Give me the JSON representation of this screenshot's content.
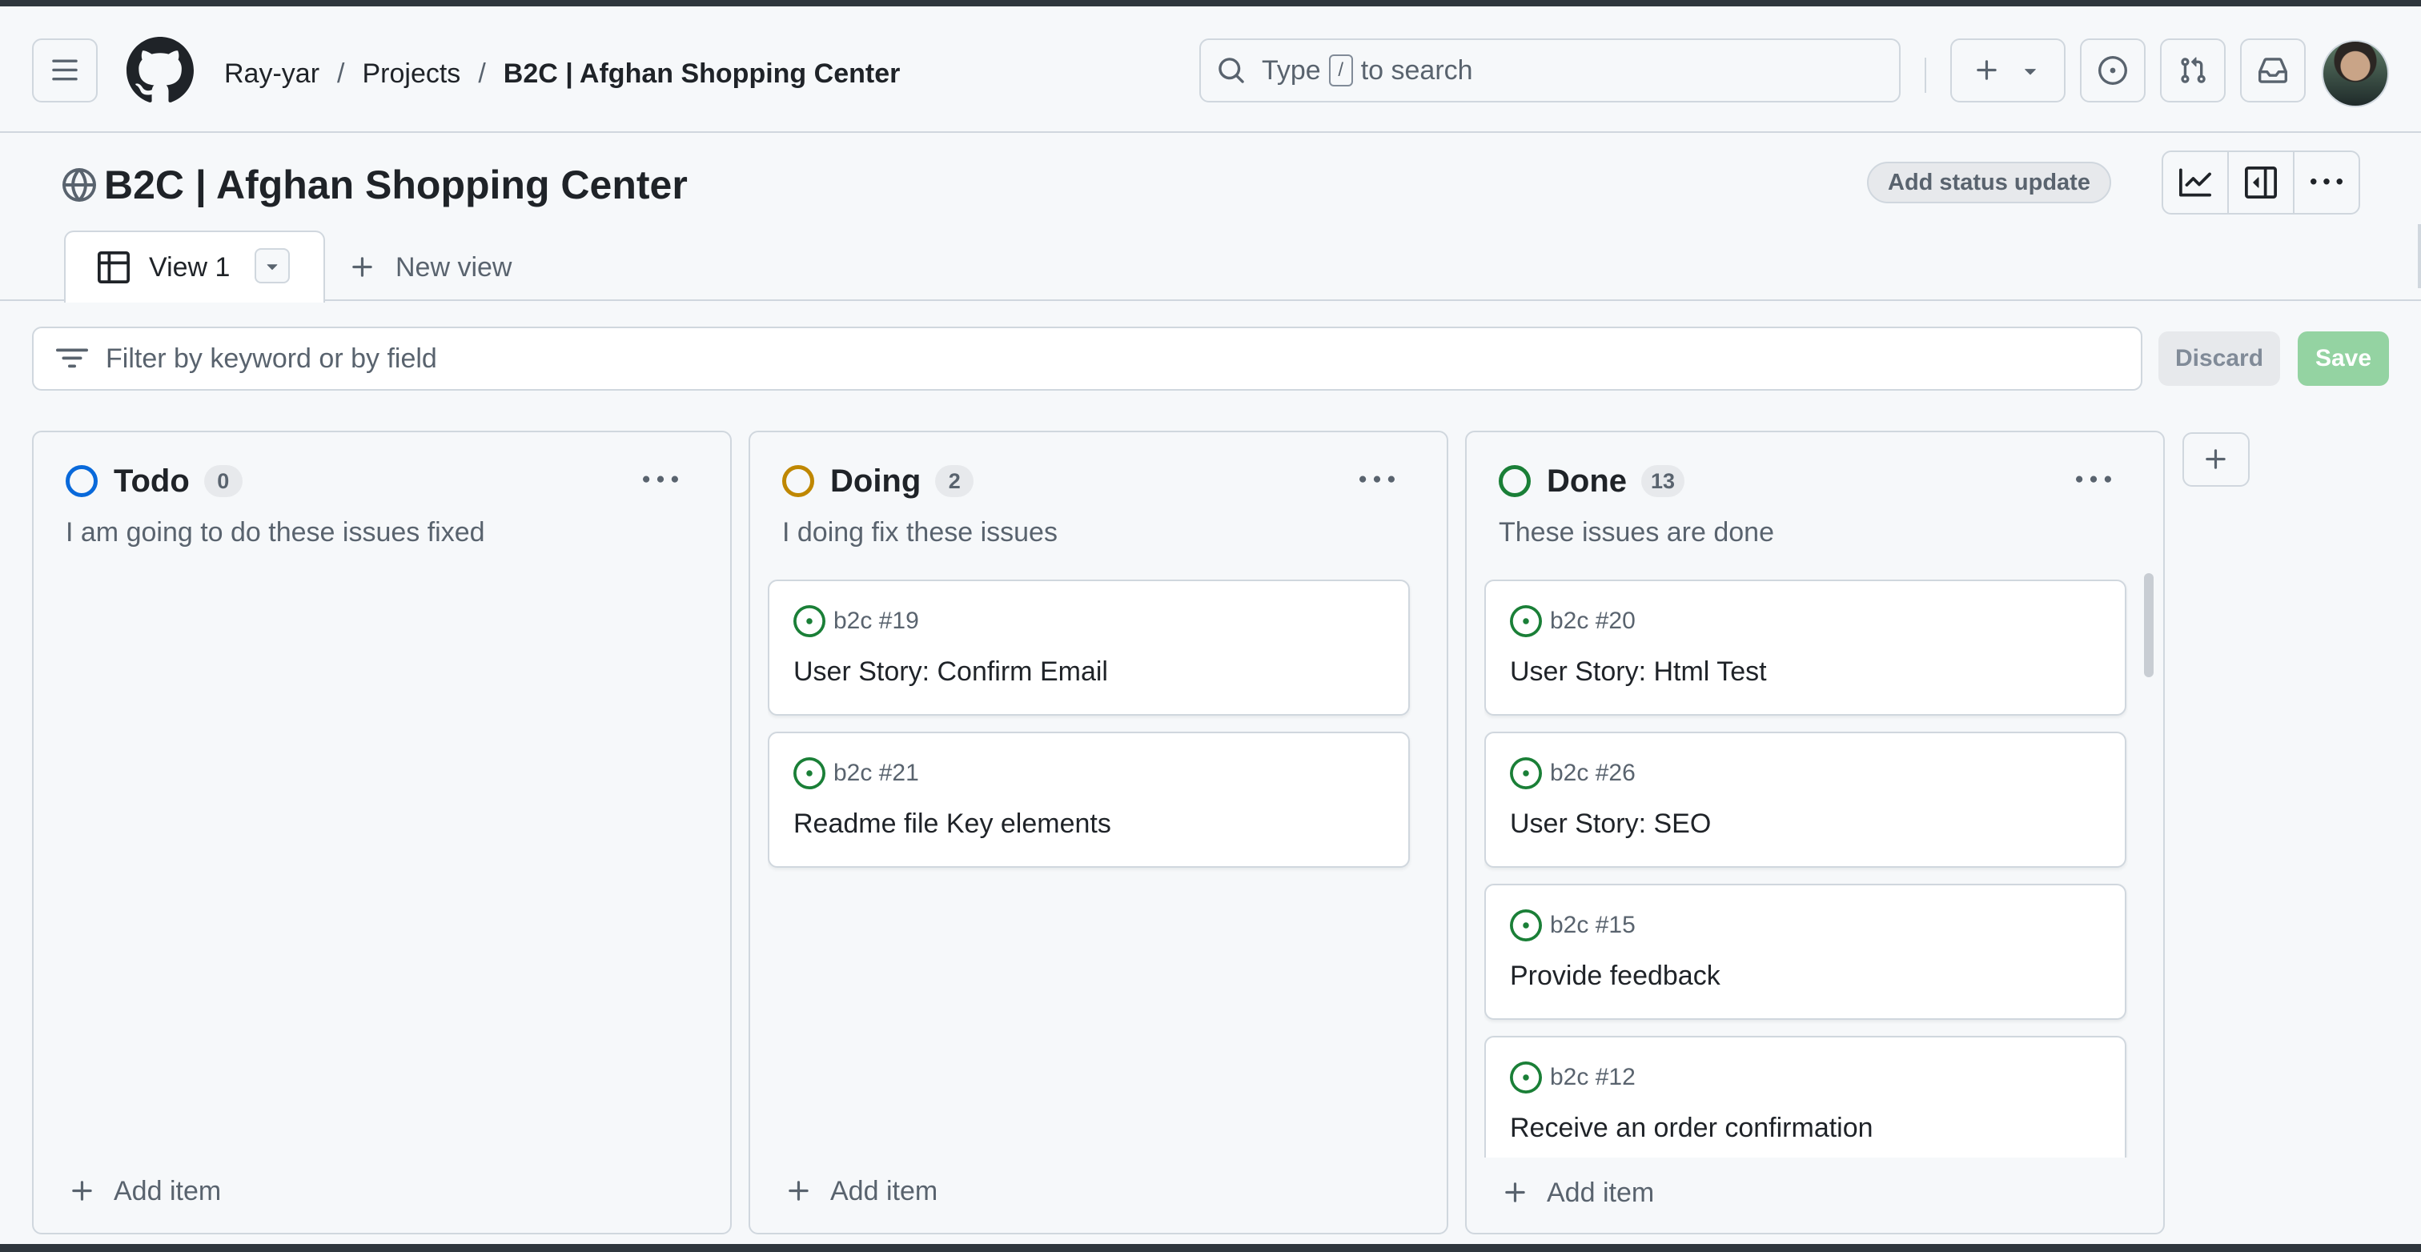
{
  "header": {
    "breadcrumbs": [
      "Ray-yar",
      "Projects",
      "B2C | Afghan Shopping Center"
    ],
    "search": {
      "prefix": "Type",
      "key": "/",
      "suffix": "to search"
    }
  },
  "project": {
    "title": "B2C | Afghan Shopping Center",
    "status_button": "Add status update"
  },
  "views": {
    "active_tab": "View 1",
    "new_view": "New view"
  },
  "filter": {
    "placeholder": "Filter by keyword or by field",
    "discard": "Discard",
    "save": "Save"
  },
  "columns": [
    {
      "name": "Todo",
      "count": "0",
      "color": "#0969da",
      "description": "I am going to do these issues fixed",
      "cards": [],
      "add_item": "Add item"
    },
    {
      "name": "Doing",
      "count": "2",
      "color": "#bf8700",
      "description": "I doing fix these issues",
      "cards": [
        {
          "ref": "b2c #19",
          "title": "User Story: Confirm Email"
        },
        {
          "ref": "b2c #21",
          "title": "Readme file Key elements"
        }
      ],
      "add_item": "Add item"
    },
    {
      "name": "Done",
      "count": "13",
      "color": "#1a7f37",
      "description": "These issues are done",
      "cards": [
        {
          "ref": "b2c #20",
          "title": "User Story: Html Test"
        },
        {
          "ref": "b2c #26",
          "title": "User Story: SEO"
        },
        {
          "ref": "b2c #15",
          "title": "Provide feedback"
        },
        {
          "ref": "b2c #12",
          "title": "Receive an order confirmation"
        }
      ],
      "add_item": "Add item"
    }
  ],
  "icons": {
    "menu": "hamburger-icon",
    "logo": "github-logo",
    "plus": "plus-icon",
    "issues": "issue-opened-icon",
    "pulls": "pull-request-icon",
    "inbox": "inbox-icon",
    "insights": "graph-icon",
    "panel": "sidebar-expand-icon",
    "more": "kebab-horizontal-icon"
  },
  "colors": {
    "accent": "#1f883d",
    "save_disabled": "#94d3a2",
    "issue_open": "#1a7f37"
  }
}
